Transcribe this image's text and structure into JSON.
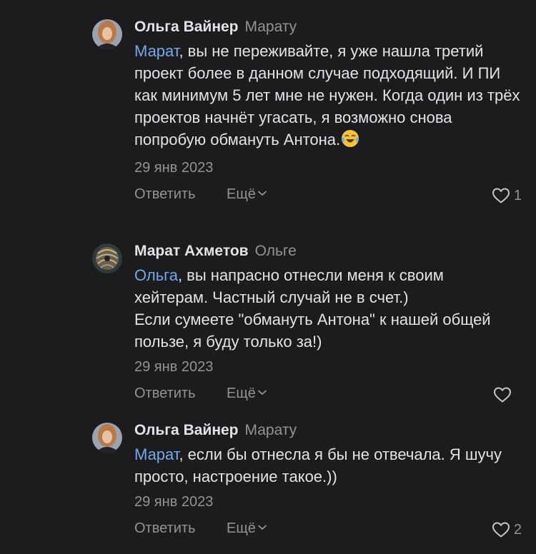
{
  "comments": [
    {
      "author": "Ольга Вайнер",
      "reply_to": "Марату",
      "mention": "Марат",
      "text": ", вы не переживайте, я уже нашла третий проект более в данном случае подходящий. И ПИ как минимум 5 лет мне не нужен. Когда один из трёх проектов начнёт угасать, я возможно снова попробую обмануть Антона.",
      "emoji": "face-with-tears-of-joy-icon",
      "date": "29 янв 2023",
      "reply_label": "Ответить",
      "more_label": "Ещё",
      "likes": "1"
    },
    {
      "author": "Марат Ахметов",
      "reply_to": "Ольге",
      "mention": "Ольга",
      "text": ", вы напрасно отнесли меня к своим хейтерам. Частный случай не в счет.)\nЕсли сумеете \"обмануть Антона\" к нашей общей пользе, я буду только за!)",
      "date": "29 янв 2023",
      "reply_label": "Ответить",
      "more_label": "Ещё",
      "likes": ""
    },
    {
      "author": "Ольга Вайнер",
      "reply_to": "Марату",
      "mention": "Марат",
      "text": ", если бы отнесла я бы не отвечала. Я шучу просто, настроение такое.))",
      "date": "29 янв 2023",
      "reply_label": "Ответить",
      "more_label": "Ещё",
      "likes": "2"
    }
  ],
  "colors": {
    "background": "#1c1c1e",
    "text": "#e1e3e6",
    "secondary": "#939393",
    "link": "#71aaeb"
  }
}
